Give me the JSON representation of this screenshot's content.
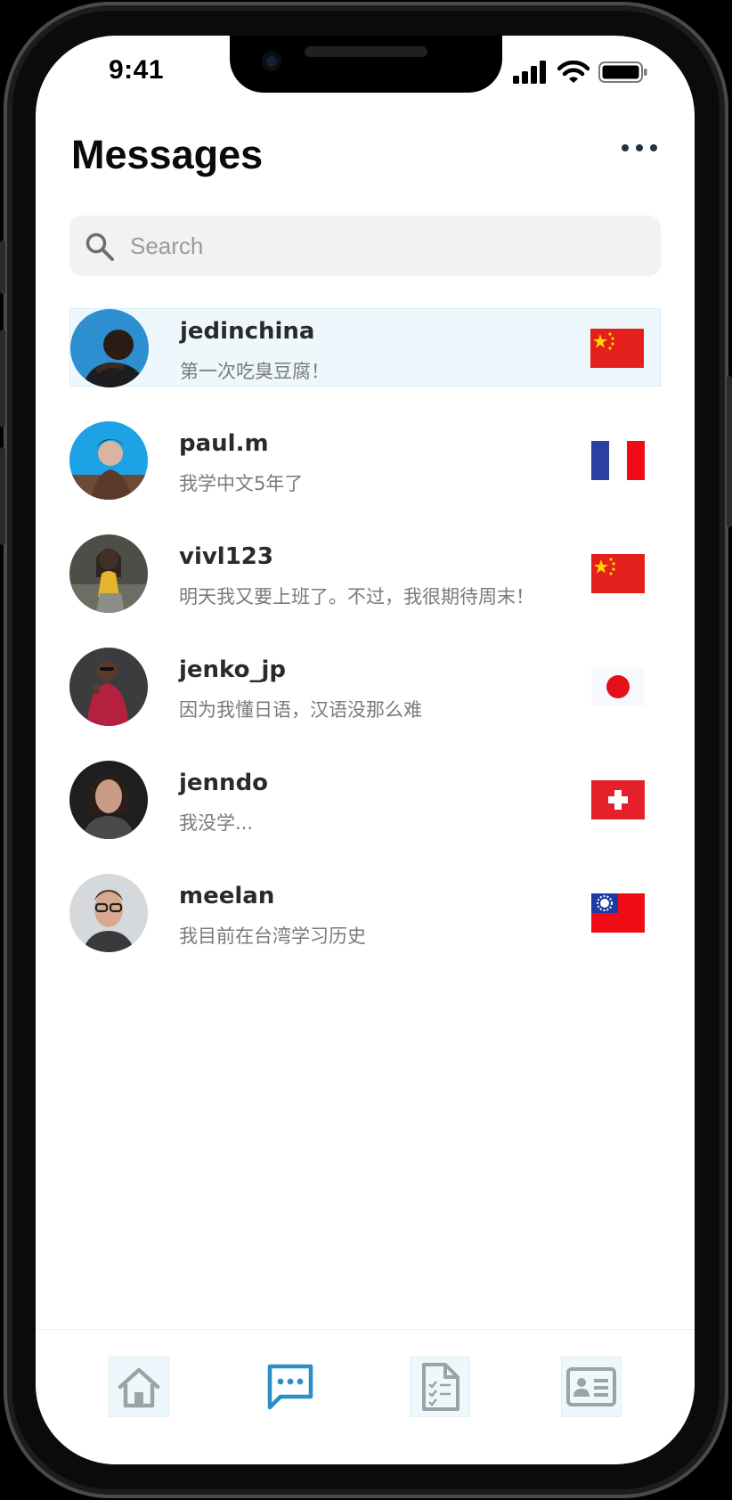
{
  "status_bar": {
    "time": "9:41"
  },
  "header": {
    "title": "Messages"
  },
  "search": {
    "placeholder": "Search",
    "value": ""
  },
  "conversations": [
    {
      "username": "jedinchina",
      "preview": "第一次吃臭豆腐！",
      "flag": "china-flag",
      "selected": true
    },
    {
      "username": "paul.m",
      "preview": "我学中文5年了",
      "flag": "france-flag",
      "selected": false
    },
    {
      "username": "vivl123",
      "preview": "明天我又要上班了。不过，我很期待周末！",
      "flag": "china-flag",
      "selected": false
    },
    {
      "username": "jenko_jp",
      "preview": "因为我懂日语，汉语没那么难",
      "flag": "japan-flag",
      "selected": false
    },
    {
      "username": "jenndo",
      "preview": "我没学...",
      "flag": "switzerland-flag",
      "selected": false
    },
    {
      "username": "meelan",
      "preview": "我目前在台湾学习历史",
      "flag": "taiwan-flag",
      "selected": false
    }
  ],
  "tab_bar": {
    "tabs": [
      {
        "icon": "home-icon",
        "active": false
      },
      {
        "icon": "chat-icon",
        "active": true
      },
      {
        "icon": "checklist-document-icon",
        "active": false
      },
      {
        "icon": "contact-card-icon",
        "active": false
      }
    ]
  },
  "colors": {
    "accent": "#2a8fc4",
    "selected_row_bg": "#eef8fc",
    "inactive_icon": "#9aa3a5",
    "title_text": "#0a0a0a",
    "preview_text": "#7a7a7a"
  }
}
